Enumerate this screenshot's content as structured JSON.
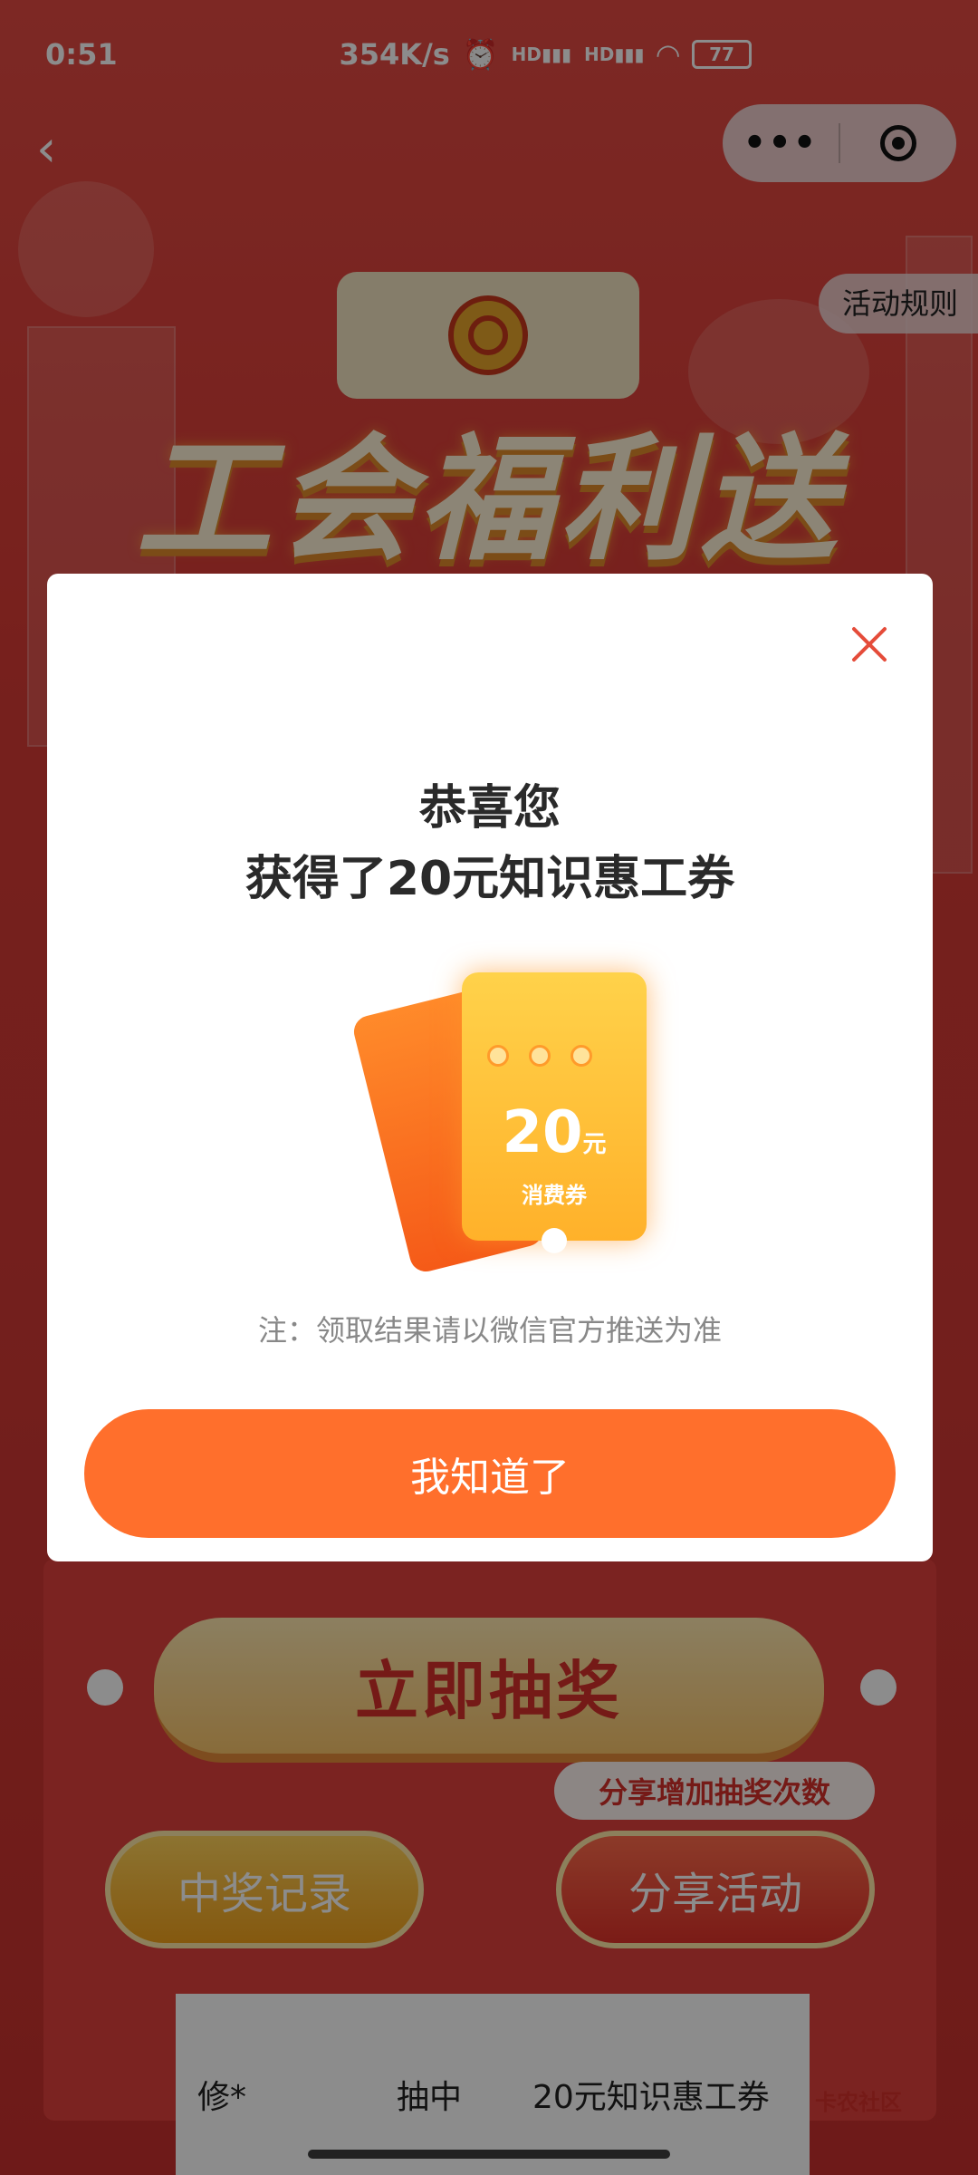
{
  "status_bar": {
    "time": "0:51",
    "network_speed": "354K/s",
    "alarm_icon": "alarm-icon",
    "signal1": "HD",
    "signal2": "HD",
    "wifi_icon": "wifi-icon",
    "battery": "77"
  },
  "header": {
    "back_icon": "chevron-left-icon",
    "capsule": {
      "more": "•••",
      "target_icon": "target-icon"
    },
    "rules_label": "活动规则"
  },
  "banner": {
    "emblem_icon": "union-emblem-icon",
    "title": "工会福利送"
  },
  "modal": {
    "title_line1": "恭喜您",
    "title_line2": "获得了20元知识惠工券",
    "coupon": {
      "amount": "20",
      "unit": "元",
      "label": "消费券"
    },
    "note": "注：领取结果请以微信官方推送为准",
    "confirm_label": "我知道了"
  },
  "background_page": {
    "draw_button": "立即抽奖",
    "share_tip": "分享增加抽奖次数",
    "record_button": "中奖记录",
    "share_button": "分享活动",
    "records": [
      {
        "name": "修*",
        "action": "抽中",
        "prize": "20元知识惠工券"
      }
    ],
    "watermark": "卡农社区"
  },
  "colors": {
    "accent": "#ff6f2c",
    "background_red": "#d93b35",
    "close_red": "#e54c3a"
  }
}
